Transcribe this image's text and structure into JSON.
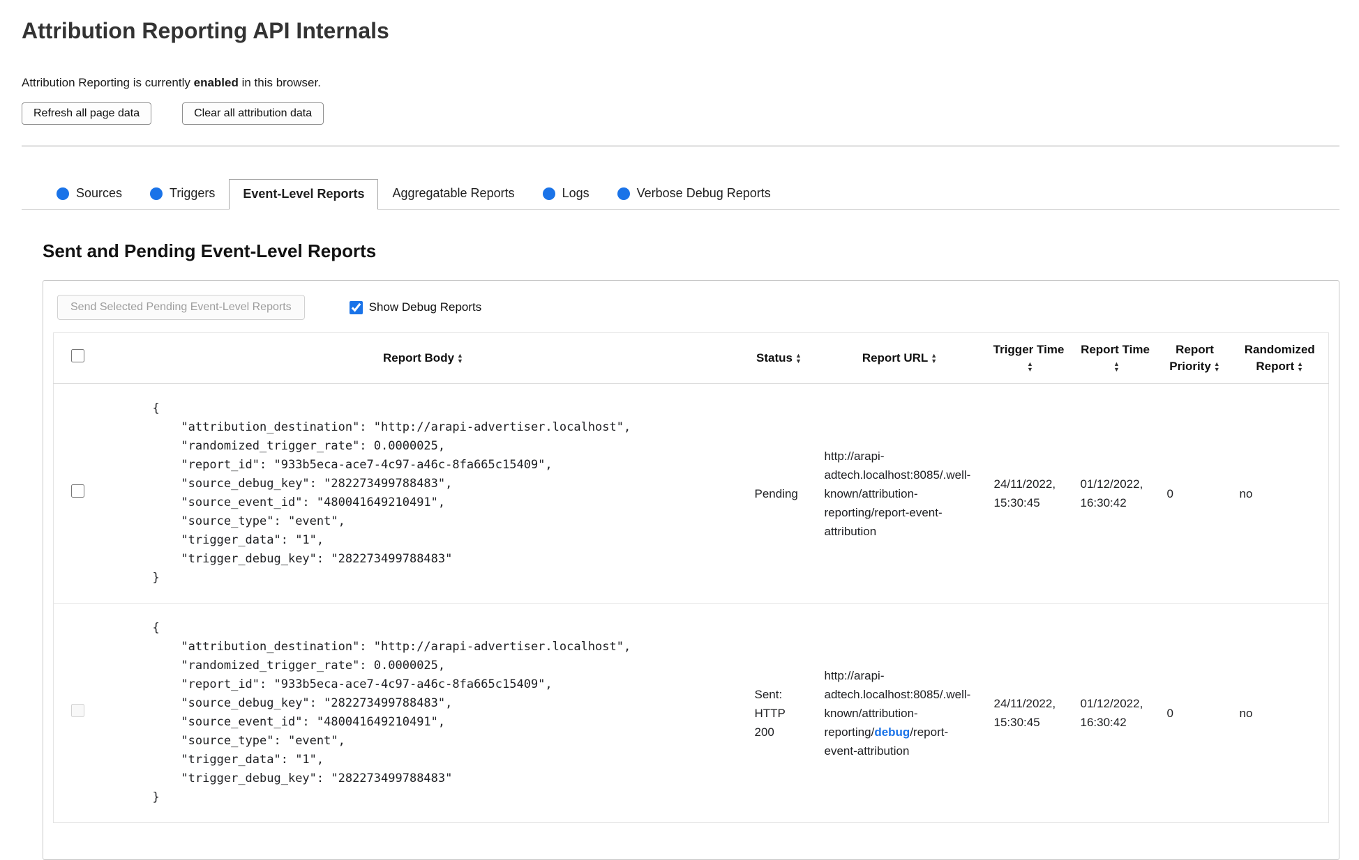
{
  "header": {
    "title": "Attribution Reporting API Internals",
    "status": {
      "prefix": "Attribution Reporting is currently ",
      "emphasis": "enabled",
      "suffix": " in this browser."
    },
    "buttons": {
      "refresh": "Refresh all page data",
      "clear": "Clear all attribution data"
    }
  },
  "colors": {
    "accent_blue": "#1a73e8"
  },
  "tabs": [
    {
      "label": "Sources",
      "has_activity_dot": true,
      "active": false
    },
    {
      "label": "Triggers",
      "has_activity_dot": true,
      "active": false
    },
    {
      "label": "Event-Level Reports",
      "has_activity_dot": false,
      "active": true
    },
    {
      "label": "Aggregatable Reports",
      "has_activity_dot": false,
      "active": false
    },
    {
      "label": "Logs",
      "has_activity_dot": true,
      "active": false
    },
    {
      "label": "Verbose Debug Reports",
      "has_activity_dot": true,
      "active": false
    }
  ],
  "reports_panel": {
    "heading": "Sent and Pending Event-Level Reports",
    "send_button": "Send Selected Pending Event-Level Reports",
    "send_button_disabled": true,
    "show_debug_label": "Show Debug Reports",
    "show_debug_checked": true,
    "select_all_checked": false,
    "sort_icon_up": "▲",
    "sort_icon_down": "▼",
    "columns": [
      "Report Body",
      "Status",
      "Report URL",
      "Trigger Time",
      "Report Time",
      "Report Priority",
      "Randomized Report"
    ],
    "rows": [
      {
        "selected": false,
        "checkbox_disabled": false,
        "report_body": "{\n    \"attribution_destination\": \"http://arapi-advertiser.localhost\",\n    \"randomized_trigger_rate\": 0.0000025,\n    \"report_id\": \"933b5eca-ace7-4c97-a46c-8fa665c15409\",\n    \"source_debug_key\": \"282273499788483\",\n    \"source_event_id\": \"480041649210491\",\n    \"source_type\": \"event\",\n    \"trigger_data\": \"1\",\n    \"trigger_debug_key\": \"282273499788483\"\n}",
        "status": "Pending",
        "url": {
          "pre": "http://arapi-adtech.localhost:8085/.well-known/attribution-reporting/report-event-attribution"
        },
        "trigger_time": "24/11/2022, 15:30:45",
        "report_time": "01/12/2022, 16:30:42",
        "report_priority": "0",
        "randomized_report": "no"
      },
      {
        "selected": false,
        "checkbox_disabled": true,
        "report_body": "{\n    \"attribution_destination\": \"http://arapi-advertiser.localhost\",\n    \"randomized_trigger_rate\": 0.0000025,\n    \"report_id\": \"933b5eca-ace7-4c97-a46c-8fa665c15409\",\n    \"source_debug_key\": \"282273499788483\",\n    \"source_event_id\": \"480041649210491\",\n    \"source_type\": \"event\",\n    \"trigger_data\": \"1\",\n    \"trigger_debug_key\": \"282273499788483\"\n}",
        "status": "Sent: HTTP 200",
        "url": {
          "pre": "http://arapi-adtech.localhost:8085/.well-known/attribution-reporting/",
          "link": "debug",
          "post": "/report-event-attribution"
        },
        "trigger_time": "24/11/2022, 15:30:45",
        "report_time": "01/12/2022, 16:30:42",
        "report_priority": "0",
        "randomized_report": "no"
      }
    ]
  }
}
